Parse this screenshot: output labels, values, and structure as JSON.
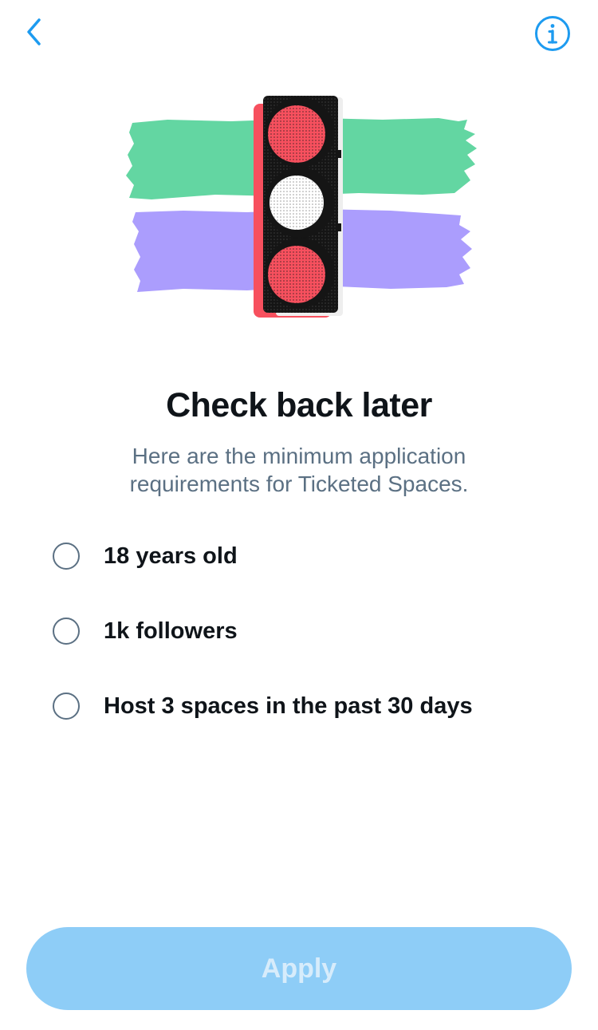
{
  "nav": {
    "back_icon": "chevron-left-icon",
    "info_icon": "info-circle-icon"
  },
  "hero": {
    "image": "traffic-light-illustration",
    "colors": {
      "green": "#63d6a2",
      "purple": "#ab9dfd",
      "red": "#f7505e",
      "dark": "#151515"
    }
  },
  "content": {
    "title": "Check back later",
    "subtitle_line1": "Here are the minimum application",
    "subtitle_line2": "requirements for Ticketed Spaces."
  },
  "requirements": [
    {
      "label": "18 years old",
      "met": false
    },
    {
      "label": "1k followers",
      "met": false
    },
    {
      "label": "Host 3 spaces in the past 30 days",
      "met": false
    }
  ],
  "footer": {
    "apply_label": "Apply",
    "apply_enabled": false
  },
  "colors": {
    "accent": "#1d9bf0",
    "button_disabled": "#8ecdf7",
    "secondary_text": "#5b7083",
    "primary_text": "#0f1419"
  }
}
